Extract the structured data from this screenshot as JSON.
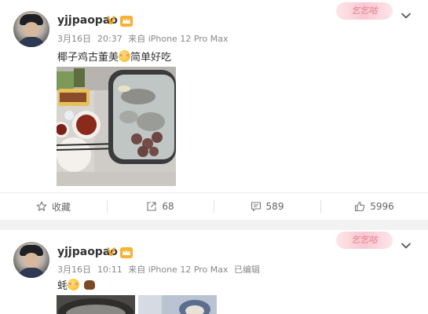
{
  "posts": [
    {
      "username": "yjjpaopao",
      "verified_badge": "V",
      "vip_badge": "VIP",
      "date": "3月16日",
      "time": "20:37",
      "source": "来自 iPhone 12 Pro Max",
      "edited": "",
      "decoration": "乞乞咕",
      "text_before_emoji": "椰子鸡古董美",
      "text_after_emoji": "简单好吃",
      "image_icon": "hotpot-photo",
      "actions": {
        "favorite_label": "收藏",
        "repost_count": "68",
        "comment_count": "589",
        "like_count": "5996"
      }
    },
    {
      "username": "yjjpaopao",
      "verified_badge": "V",
      "vip_badge": "VIP",
      "date": "3月16日",
      "time": "10:11",
      "source": "来自 iPhone 12 Pro Max",
      "edited": "已编辑",
      "decoration": "乞乞咕",
      "text_before_emoji": "蚝",
      "text_after_emoji": "",
      "image_icon": "food-photo"
    }
  ],
  "colors": {
    "background": "#f2f2f2",
    "card": "#ffffff",
    "badge_gold": "#f5a623",
    "decor_pink": "#f9c2cc"
  }
}
